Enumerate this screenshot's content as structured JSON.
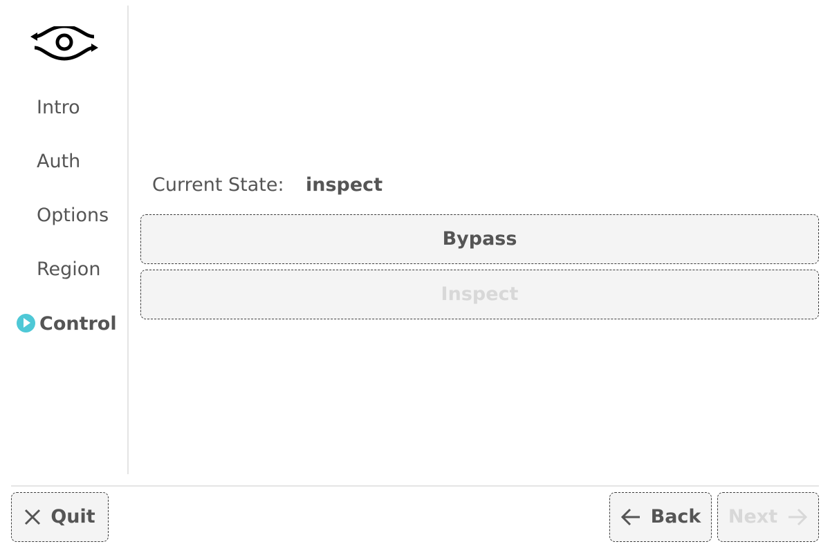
{
  "sidebar": {
    "logo_icon": "eye-arrows-logo-icon",
    "items": [
      {
        "label": "Intro",
        "active": false
      },
      {
        "label": "Auth",
        "active": false
      },
      {
        "label": "Options",
        "active": false
      },
      {
        "label": "Region",
        "active": false
      },
      {
        "label": "Control",
        "active": true,
        "icon": "play-circle-icon"
      }
    ]
  },
  "main": {
    "state_label": "Current State:",
    "state_value": "inspect",
    "buttons": [
      {
        "label": "Bypass",
        "enabled": true
      },
      {
        "label": "Inspect",
        "enabled": false
      }
    ]
  },
  "footer": {
    "quit_label": "Quit",
    "quit_icon": "close-icon",
    "back_label": "Back",
    "back_icon": "arrow-left-icon",
    "next_label": "Next",
    "next_icon": "arrow-right-icon",
    "next_enabled": false
  },
  "colors": {
    "accent": "#4ec8d6",
    "text": "#555555",
    "disabled_text": "#d8d8d8",
    "button_bg": "#f4f4f4",
    "divider": "#e4e4e4"
  }
}
